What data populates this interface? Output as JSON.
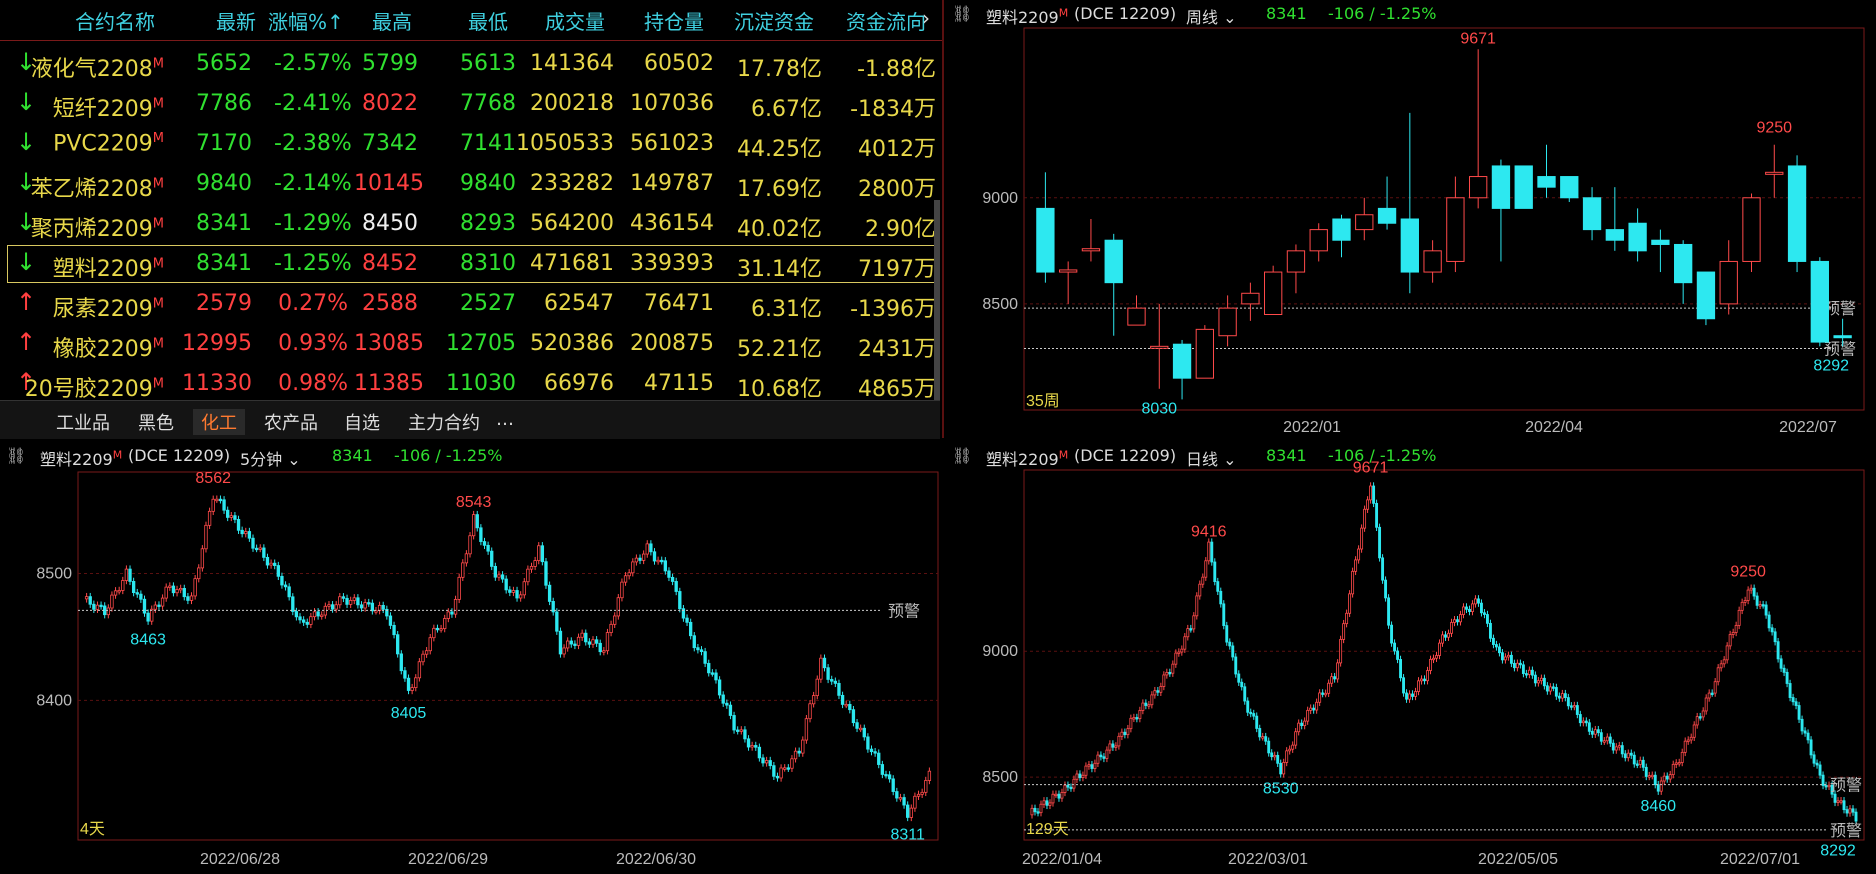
{
  "quote": {
    "headers": [
      "合约名称",
      "最新",
      "涨幅%↑",
      "最高",
      "最低",
      "成交量",
      "持仓量",
      "沉淀资金",
      "资金流向"
    ],
    "rows": [
      {
        "dir": "down",
        "name": "液化气2208",
        "last": "5652",
        "chg": "-2.57%",
        "high": "5799",
        "low": "5613",
        "vol": "141364",
        "oi": "60502",
        "fund": "17.78亿",
        "flow": "-1.88亿",
        "last_c": "green",
        "high_c": "green",
        "low_c": "green"
      },
      {
        "dir": "down",
        "name": "短纤2209",
        "last": "7786",
        "chg": "-2.41%",
        "high": "8022",
        "low": "7768",
        "vol": "200218",
        "oi": "107036",
        "fund": "6.67亿",
        "flow": "-1834万",
        "last_c": "green",
        "high_c": "red",
        "low_c": "green"
      },
      {
        "dir": "down",
        "name": "PVC2209",
        "last": "7170",
        "chg": "-2.38%",
        "high": "7342",
        "low": "7141",
        "vol": "1050533",
        "oi": "561023",
        "fund": "44.25亿",
        "flow": "4012万",
        "last_c": "green",
        "high_c": "green",
        "low_c": "green"
      },
      {
        "dir": "down",
        "name": "苯乙烯2208",
        "last": "9840",
        "chg": "-2.14%",
        "high": "10145",
        "low": "9840",
        "vol": "233282",
        "oi": "149787",
        "fund": "17.69亿",
        "flow": "2800万",
        "last_c": "green",
        "high_c": "red",
        "low_c": "green"
      },
      {
        "dir": "down",
        "name": "聚丙烯2209",
        "last": "8341",
        "chg": "-1.29%",
        "high": "8450",
        "low": "8293",
        "vol": "564200",
        "oi": "436154",
        "fund": "40.02亿",
        "flow": "2.90亿",
        "last_c": "green",
        "high_c": "white",
        "low_c": "green"
      },
      {
        "dir": "down",
        "name": "塑料2209",
        "last": "8341",
        "chg": "-1.25%",
        "high": "8452",
        "low": "8310",
        "vol": "471681",
        "oi": "339393",
        "fund": "31.14亿",
        "flow": "7197万",
        "last_c": "green",
        "high_c": "red",
        "low_c": "green",
        "selected": true
      },
      {
        "dir": "up",
        "name": "尿素2209",
        "last": "2579",
        "chg": "0.27%",
        "high": "2588",
        "low": "2527",
        "vol": "62547",
        "oi": "76471",
        "fund": "6.31亿",
        "flow": "-1396万",
        "last_c": "red",
        "high_c": "red",
        "low_c": "green"
      },
      {
        "dir": "up",
        "name": "橡胶2209",
        "last": "12995",
        "chg": "0.93%",
        "high": "13085",
        "low": "12705",
        "vol": "520386",
        "oi": "200875",
        "fund": "52.21亿",
        "flow": "2431万",
        "last_c": "red",
        "high_c": "red",
        "low_c": "green"
      },
      {
        "dir": "up",
        "name": "20号胶2209",
        "last": "11330",
        "chg": "0.98%",
        "high": "11385",
        "low": "11030",
        "vol": "66976",
        "oi": "47115",
        "fund": "10.68亿",
        "flow": "4865万",
        "last_c": "red",
        "high_c": "red",
        "low_c": "green"
      }
    ],
    "tabs": [
      "工业品",
      "黑色",
      "化工",
      "农产品",
      "自选",
      "主力合约",
      "…"
    ],
    "active_tab": "化工",
    "more_icon": "chevron-right-icon"
  },
  "weekly": {
    "symbol": "塑料2209",
    "mark": "M",
    "code": "(DCE 12209)",
    "period": "周线",
    "price": "8341",
    "change": "-106 / -1.25%",
    "yticks": [
      "9000",
      "8500"
    ],
    "xticks": [
      "2022/01",
      "2022/04",
      "2022/07"
    ],
    "count": "35周",
    "hi1": "9671",
    "hi2": "9250",
    "lo1": "8030",
    "lo2": "8292",
    "alert": "预警"
  },
  "min5": {
    "symbol": "塑料2209",
    "mark": "M",
    "code": "(DCE 12209)",
    "period": "5分钟",
    "price": "8341",
    "change": "-106 / -1.25%",
    "yticks": [
      "8500",
      "8400"
    ],
    "xticks": [
      "2022/06/28",
      "2022/06/29",
      "2022/06/30"
    ],
    "count": "4天",
    "hi1": "8562",
    "hi2": "8543",
    "lo1": "8463",
    "lo2": "8405",
    "lo3": "8311",
    "alert": "预警"
  },
  "daily": {
    "symbol": "塑料2209",
    "mark": "M",
    "code": "(DCE 12209)",
    "period": "日线",
    "price": "8341",
    "change": "-106 / -1.25%",
    "yticks": [
      "9000",
      "8500"
    ],
    "xticks": [
      "2022/01/04",
      "2022/03/01",
      "2022/05/05",
      "2022/07/01"
    ],
    "count": "129天",
    "hi1": "9416",
    "hi2": "9671",
    "hi3": "9250",
    "lo1": "8530",
    "lo2": "8460",
    "lo3": "8292",
    "alert": "预警"
  },
  "chart_data": [
    {
      "type": "candlestick",
      "title": "塑料2209 周线",
      "ylim": [
        8000,
        9800
      ],
      "candles": [
        [
          8950,
          8650,
          9120,
          8600
        ],
        [
          8650,
          8660,
          8700,
          8500
        ],
        [
          8750,
          8760,
          8900,
          8700
        ],
        [
          8800,
          8600,
          8830,
          8350
        ],
        [
          8400,
          8480,
          8540,
          8400
        ],
        [
          8300,
          8300,
          8500,
          8100
        ],
        [
          8310,
          8150,
          8330,
          8050
        ],
        [
          8150,
          8380,
          8400,
          8150
        ],
        [
          8350,
          8480,
          8540,
          8300
        ],
        [
          8500,
          8550,
          8600,
          8420
        ],
        [
          8450,
          8650,
          8680,
          8450
        ],
        [
          8650,
          8750,
          8780,
          8550
        ],
        [
          8750,
          8850,
          8880,
          8700
        ],
        [
          8900,
          8800,
          8920,
          8720
        ],
        [
          8850,
          8920,
          9000,
          8800
        ],
        [
          8950,
          8880,
          9100,
          8850
        ],
        [
          8900,
          8650,
          9400,
          8550
        ],
        [
          8650,
          8750,
          8800,
          8600
        ],
        [
          8700,
          9000,
          9100,
          8650
        ],
        [
          9000,
          9100,
          9700,
          8950
        ],
        [
          9150,
          8950,
          9180,
          8700
        ],
        [
          9150,
          8950,
          9150,
          8950
        ],
        [
          9100,
          9050,
          9250,
          9000
        ],
        [
          9100,
          9000,
          9100,
          8980
        ],
        [
          9000,
          8850,
          9050,
          8800
        ],
        [
          8850,
          8800,
          9050,
          8750
        ],
        [
          8880,
          8750,
          8950,
          8700
        ],
        [
          8800,
          8780,
          8850,
          8650
        ],
        [
          8780,
          8600,
          8800,
          8500
        ],
        [
          8650,
          8430,
          8650,
          8400
        ],
        [
          8500,
          8700,
          8800,
          8450
        ],
        [
          8700,
          9000,
          9020,
          8650
        ],
        [
          9120,
          9120,
          9250,
          9000
        ],
        [
          9150,
          8700,
          9200,
          8650
        ],
        [
          8700,
          8320,
          8720,
          8300
        ],
        [
          8350,
          8341,
          8430,
          8300
        ]
      ]
    },
    {
      "type": "line",
      "title": "塑料2209 5分钟",
      "ylim": [
        8290,
        8580
      ],
      "values": [
        8480,
        8470,
        8500,
        8465,
        8490,
        8480,
        8562,
        8540,
        8520,
        8500,
        8460,
        8470,
        8480,
        8475,
        8470,
        8405,
        8450,
        8470,
        8543,
        8500,
        8480,
        8520,
        8440,
        8450,
        8440,
        8500,
        8520,
        8500,
        8450,
        8420,
        8380,
        8360,
        8340,
        8360,
        8430,
        8400,
        8370,
        8340,
        8311,
        8341
      ]
    },
    {
      "type": "line",
      "title": "塑料2209 日线",
      "ylim": [
        8250,
        9720
      ],
      "values": [
        8350,
        8400,
        8450,
        8520,
        8580,
        8650,
        8750,
        8830,
        8950,
        9100,
        9416,
        9050,
        8800,
        8650,
        8530,
        8700,
        8800,
        8900,
        9300,
        9671,
        9100,
        8800,
        8900,
        9050,
        9150,
        9200,
        9000,
        8950,
        8900,
        8850,
        8800,
        8700,
        8650,
        8600,
        8550,
        8460,
        8550,
        8700,
        8850,
        9050,
        9250,
        9150,
        8900,
        8700,
        8500,
        8400,
        8341
      ]
    }
  ]
}
